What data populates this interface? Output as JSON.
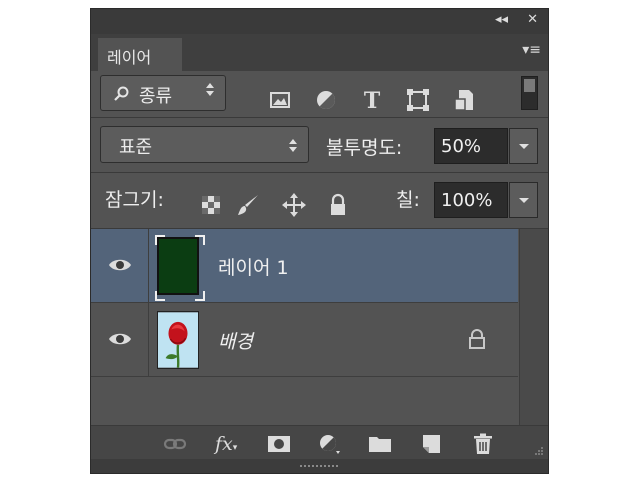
{
  "titlebar": {
    "collapse_glyph": "◂◂",
    "close_glyph": "✕"
  },
  "tab": {
    "label": "레이어"
  },
  "panel_menu_glyph": "▾≡",
  "filter": {
    "kind_label": "종류",
    "search_icon": "search-icon",
    "icons": [
      "pixel-layer-filter-icon",
      "adjustment-layer-filter-icon",
      "type-layer-filter-icon",
      "shape-layer-filter-icon",
      "smart-object-filter-icon",
      "filter-toggle-switch"
    ]
  },
  "blend": {
    "mode": "표준",
    "opacity_label": "불투명도:",
    "opacity_value": "50%"
  },
  "lock": {
    "label": "잠그기:",
    "fill_label": "칠:",
    "fill_value": "100%",
    "icons": [
      "lock-transparent-pixels-icon",
      "lock-image-pixels-icon",
      "lock-position-icon",
      "lock-all-icon"
    ]
  },
  "layers": [
    {
      "name": "레이어 1",
      "selected": true,
      "thumb_color": "#0b3d12",
      "locked": false
    },
    {
      "name": "배경",
      "selected": false,
      "thumb": "red-rose-image",
      "locked": true
    }
  ],
  "colors": {
    "selected_row": "#53647a",
    "panel_bg": "#535353"
  },
  "bottom_icons": [
    "link-layers-icon",
    "fx-icon",
    "add-mask-icon",
    "new-adjustment-layer-icon",
    "new-group-folder-icon",
    "new-layer-icon",
    "trash-icon"
  ],
  "fx_text": "fx"
}
